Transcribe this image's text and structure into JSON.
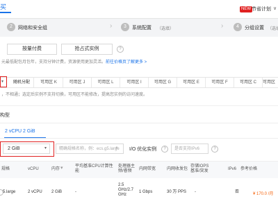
{
  "top": {
    "active_tab": "买",
    "badge": "NEW",
    "saver_label": "节省计划",
    "saver_caret": "∨"
  },
  "steps": [
    {
      "num": "2",
      "label": "网络和安全组",
      "sub": ""
    },
    {
      "num": "3",
      "label": "系统配置",
      "sub": "（选填）"
    },
    {
      "num": "4",
      "label": "分组设置",
      "sub": "（选填）"
    }
  ],
  "billing": {
    "options": [
      "按量付费",
      "抢占式实例"
    ],
    "note_prefix": "元最低配包月包年，支持分钟计费，资源使用更加灵活。",
    "note_link": "前往价格页了解更多 >"
  },
  "zones": {
    "selected": "随机分配",
    "items": [
      "可用区 K",
      "可用区 J",
      "可用区 L",
      "可用区 I",
      "可用区 G",
      "可用区 E",
      "可用区 F",
      "可用区 C",
      "可用区"
    ],
    "note": "，不相通；选定后实例不支持切换，可用区不能修改，提高您实例的访问速度。"
  },
  "sub_tab": "构型",
  "vcpu_tab": "2 vCPU 2 GiB",
  "filters": {
    "memory_value": "2 GiB",
    "search_placeholder": "精确规格名称，例：ecs.g5.large",
    "io_label": "I/O 优化实例",
    "ipv6_placeholder": "是否支持IPv6"
  },
  "table": {
    "headers": [
      "规格",
      "vCPU",
      "内存",
      "平均基准CPU计算性能",
      "处理器主频/睿频",
      "内网带宽",
      "内网收发包",
      "存储IOPS\n基准/突发",
      "IPv6",
      "参考价格"
    ],
    "row": {
      "spec": "5.large",
      "vcpu": "2 vCPU",
      "memory": "2 GiB",
      "baseline": "-",
      "freq": "2.5\nGHz/2.7\nGHz",
      "bandwidth": "1 Gbps",
      "pps": "30 万 PPS",
      "iops": "-",
      "ipv6": "否",
      "price": "¥ 170.0 /月"
    }
  },
  "colors": {
    "accent": "#1a73e8",
    "alert": "#e02020",
    "price": "#f5620a"
  }
}
